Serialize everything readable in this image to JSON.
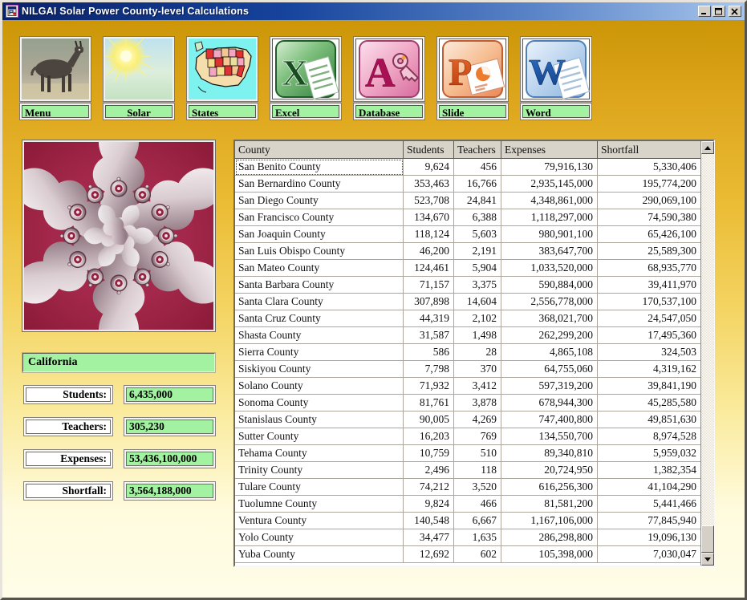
{
  "window": {
    "title": "NILGAI Solar Power County-level Calculations",
    "title_icon": "form-app-icon",
    "controls": {
      "minimize": "minimize-button",
      "maximize": "maximize-button",
      "close": "close-button"
    }
  },
  "toolbar": {
    "buttons": [
      {
        "label": "Menu",
        "icon": "nilgai-photo-icon"
      },
      {
        "label": "Solar",
        "icon": "sun-icon"
      },
      {
        "label": "States",
        "icon": "us-states-map-icon"
      },
      {
        "label": "Excel",
        "icon": "excel-icon"
      },
      {
        "label": "Database",
        "icon": "access-database-icon"
      },
      {
        "label": "Slide",
        "icon": "powerpoint-icon"
      },
      {
        "label": "Word",
        "icon": "word-icon"
      }
    ]
  },
  "picture": {
    "description": "red and silver metallic fractal kaleidoscope"
  },
  "state_panel": {
    "state_name": "California",
    "fields": [
      {
        "label": "Students:",
        "value": "6,435,000"
      },
      {
        "label": "Teachers:",
        "value": "305,230"
      },
      {
        "label": "Expenses:",
        "value": "53,436,100,000"
      },
      {
        "label": "Shortfall:",
        "value": "3,564,188,000"
      }
    ]
  },
  "table": {
    "columns": [
      "County",
      "Students",
      "Teachers",
      "Expenses",
      "Shortfall"
    ],
    "selection": {
      "row": 0,
      "column": 0
    },
    "rows": [
      [
        "San Benito County",
        "9,624",
        "456",
        "79,916,130",
        "5,330,406"
      ],
      [
        "San Bernardino County",
        "353,463",
        "16,766",
        "2,935,145,000",
        "195,774,200"
      ],
      [
        "San Diego County",
        "523,708",
        "24,841",
        "4,348,861,000",
        "290,069,100"
      ],
      [
        "San Francisco County",
        "134,670",
        "6,388",
        "1,118,297,000",
        "74,590,380"
      ],
      [
        "San Joaquin County",
        "118,124",
        "5,603",
        "980,901,100",
        "65,426,100"
      ],
      [
        "San Luis Obispo County",
        "46,200",
        "2,191",
        "383,647,700",
        "25,589,300"
      ],
      [
        "San Mateo County",
        "124,461",
        "5,904",
        "1,033,520,000",
        "68,935,770"
      ],
      [
        "Santa Barbara County",
        "71,157",
        "3,375",
        "590,884,000",
        "39,411,970"
      ],
      [
        "Santa Clara County",
        "307,898",
        "14,604",
        "2,556,778,000",
        "170,537,100"
      ],
      [
        "Santa Cruz County",
        "44,319",
        "2,102",
        "368,021,700",
        "24,547,050"
      ],
      [
        "Shasta County",
        "31,587",
        "1,498",
        "262,299,200",
        "17,495,360"
      ],
      [
        "Sierra County",
        "586",
        "28",
        "4,865,108",
        "324,503"
      ],
      [
        "Siskiyou County",
        "7,798",
        "370",
        "64,755,060",
        "4,319,162"
      ],
      [
        "Solano County",
        "71,932",
        "3,412",
        "597,319,200",
        "39,841,190"
      ],
      [
        "Sonoma County",
        "81,761",
        "3,878",
        "678,944,300",
        "45,285,580"
      ],
      [
        "Stanislaus County",
        "90,005",
        "4,269",
        "747,400,800",
        "49,851,630"
      ],
      [
        "Sutter County",
        "16,203",
        "769",
        "134,550,700",
        "8,974,528"
      ],
      [
        "Tehama County",
        "10,759",
        "510",
        "89,340,810",
        "5,959,032"
      ],
      [
        "Trinity County",
        "2,496",
        "118",
        "20,724,950",
        "1,382,354"
      ],
      [
        "Tulare County",
        "74,212",
        "3,520",
        "616,256,300",
        "41,104,290"
      ],
      [
        "Tuolumne County",
        "9,824",
        "466",
        "81,581,200",
        "5,441,466"
      ],
      [
        "Ventura County",
        "140,548",
        "6,667",
        "1,167,106,000",
        "77,845,940"
      ],
      [
        "Yolo County",
        "34,477",
        "1,635",
        "286,298,800",
        "19,096,130"
      ],
      [
        "Yuba County",
        "12,692",
        "602",
        "105,398,000",
        "7,030,047"
      ]
    ]
  },
  "colors": {
    "title_gradient_start": "#0A2268",
    "title_gradient_end": "#A8C6EC",
    "background_top": "#CC9608",
    "background_bottom": "#FFFDE8",
    "accent_green": "#A2F2A2",
    "header_gray": "#D8D4CA",
    "fractal_red": "#9A2244"
  }
}
